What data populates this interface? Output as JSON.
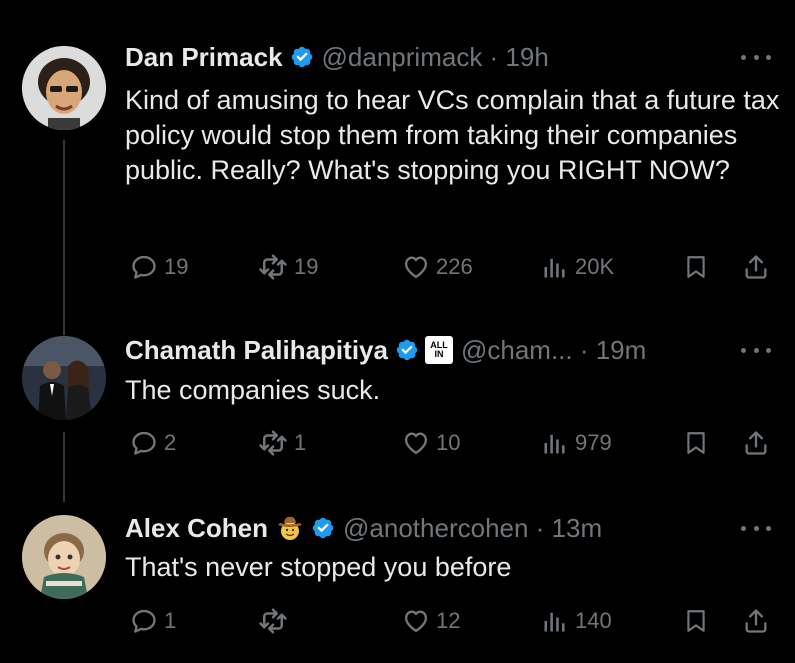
{
  "tweets": [
    {
      "name": "Dan Primack",
      "handle_time": "@danprimack · 19h",
      "text": "Kind of amusing to hear VCs complain that a future tax policy would stop them from taking their companies public. Really? What's stopping you RIGHT NOW?",
      "replies": "19",
      "reposts": "19",
      "likes": "226",
      "views": "20K"
    },
    {
      "name": "Chamath Palihapitiya",
      "badge_line1": "ALL",
      "badge_line2": "IN",
      "handle_time": "@cham... · 19m",
      "text": "The companies suck.",
      "replies": "2",
      "reposts": "1",
      "likes": "10",
      "views": "979"
    },
    {
      "name": "Alex Cohen",
      "handle_time": "@anothercohen · 13m",
      "text": "That's never stopped you before",
      "replies": "1",
      "reposts": "",
      "likes": "12",
      "views": "140"
    }
  ],
  "colors": {
    "background": "#000000",
    "text": "#e7e9ea",
    "muted": "#71767b",
    "verified": "#1d9bf0"
  },
  "icons": [
    "verified-icon",
    "more-icon",
    "reply-icon",
    "repost-icon",
    "like-icon",
    "views-icon",
    "bookmark-icon",
    "share-icon"
  ]
}
